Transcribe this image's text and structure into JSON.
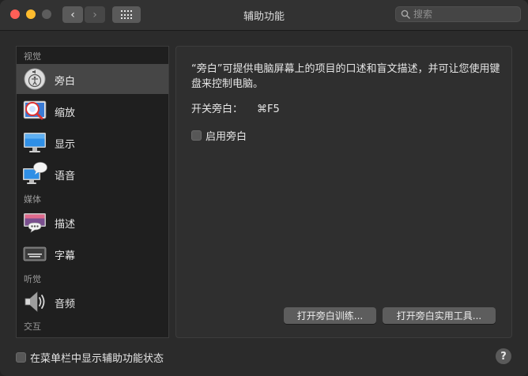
{
  "window": {
    "title": "辅助功能"
  },
  "toolbar": {
    "back_glyph": "‹",
    "forward_glyph": "›",
    "search_placeholder": "搜索"
  },
  "sidebar": {
    "sections": {
      "vision": "视觉",
      "media": "媒体",
      "hearing": "听觉",
      "interaction": "交互"
    },
    "items": [
      {
        "label": "旁白",
        "icon": "voiceover-icon",
        "selected": true
      },
      {
        "label": "缩放",
        "icon": "zoom-icon",
        "selected": false
      },
      {
        "label": "显示",
        "icon": "display-icon",
        "selected": false
      },
      {
        "label": "语音",
        "icon": "speech-icon",
        "selected": false
      },
      {
        "label": "描述",
        "icon": "descriptions-icon",
        "selected": false
      },
      {
        "label": "字幕",
        "icon": "captions-icon",
        "selected": false
      },
      {
        "label": "音频",
        "icon": "audio-icon",
        "selected": false
      }
    ]
  },
  "panel": {
    "description": "“旁白”可提供电脑屏幕上的项目的口述和盲文描述，并可让您使用键盘来控制电脑。",
    "shortcut_label": "开关旁白：",
    "shortcut_key": "⌘F5",
    "enable_label": "启用旁白",
    "training_button": "打开旁白训练...",
    "utility_button": "打开旁白实用工具..."
  },
  "footer": {
    "menubar_status_label": "在菜单栏中显示辅助功能状态",
    "help_glyph": "?"
  }
}
